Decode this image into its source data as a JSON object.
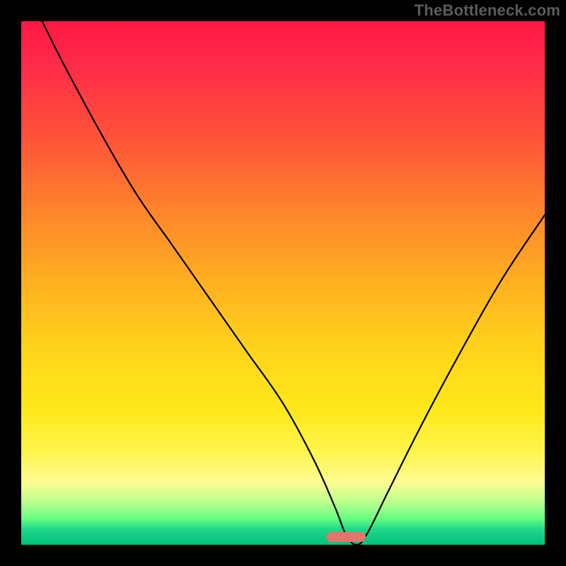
{
  "watermark": "TheBottleneck.com",
  "chart_data": {
    "type": "line",
    "title": "",
    "xlabel": "",
    "ylabel": "",
    "xlim": [
      0,
      100
    ],
    "ylim": [
      0,
      100
    ],
    "grid": false,
    "series": [
      {
        "name": "curve",
        "x": [
          4,
          8,
          15,
          22,
          29,
          36,
          43,
          50,
          56,
          60,
          62,
          64,
          66,
          70,
          76,
          84,
          92,
          100
        ],
        "values": [
          100,
          92,
          79,
          67,
          57,
          47,
          37,
          27,
          16,
          7,
          2,
          0,
          2,
          10,
          22,
          37,
          51,
          63
        ]
      }
    ],
    "annotations": [
      {
        "type": "marker",
        "x_center_pct": 62,
        "y_pct": 98.5,
        "width_pct": 7.5
      }
    ],
    "background": "red-yellow-green-vertical-gradient",
    "watermark": "TheBottleneck.com"
  }
}
